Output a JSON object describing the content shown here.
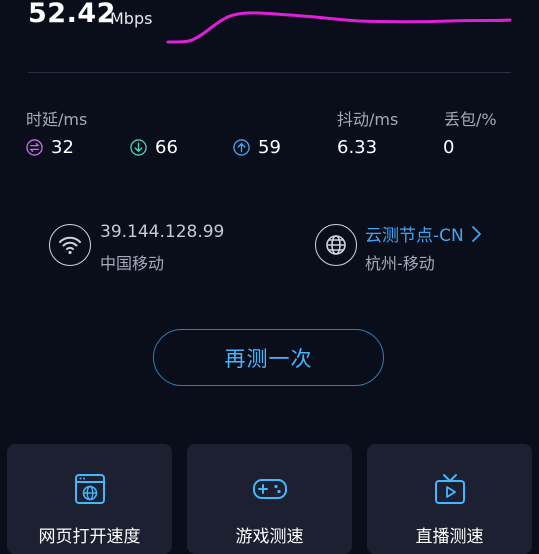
{
  "speed": {
    "value": "52.42",
    "unit": "Mbps"
  },
  "stats": {
    "latency_label": "时延/ms",
    "idle_ping": "32",
    "download_ping": "66",
    "upload_ping": "59",
    "jitter_label": "抖动/ms",
    "jitter": "6.33",
    "loss_label": "丢包/%",
    "loss": "0"
  },
  "network": {
    "ip": "39.144.128.99",
    "isp": "中国移动"
  },
  "server": {
    "name": "云测节点-CN",
    "location": "杭州-移动"
  },
  "retest_label": "再测一次",
  "cards": [
    {
      "title": "网页打开速度",
      "icon": "browser-globe-icon"
    },
    {
      "title": "游戏测速",
      "icon": "gamepad-icon"
    },
    {
      "title": "直播测速",
      "icon": "tv-play-icon"
    }
  ],
  "colors": {
    "background": "#0a0d1a",
    "graph_line": "#e020d8",
    "accent": "#43b8ff",
    "card": "#1c2030",
    "idle_icon": "#c870f0",
    "down_icon": "#4fd1c1",
    "up_icon": "#4aa8f5"
  }
}
